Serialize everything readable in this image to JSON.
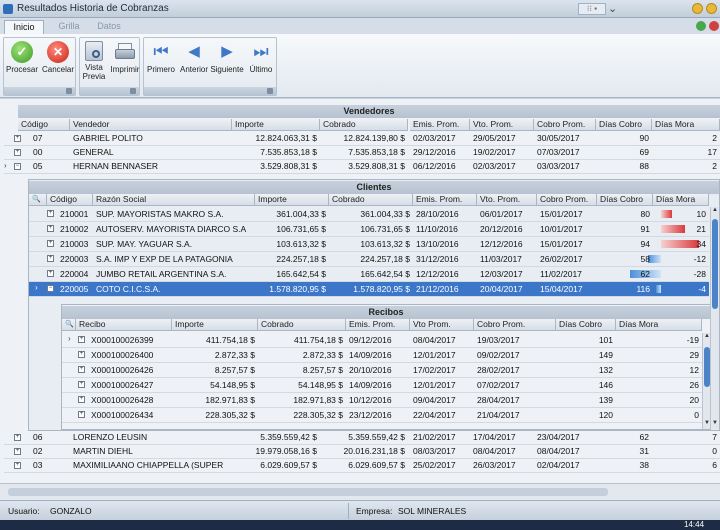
{
  "window": {
    "title": "Resultados Historia de Cobranzas"
  },
  "tabs": [
    {
      "label": "Inicio"
    },
    {
      "label": "Grilla"
    },
    {
      "label": "Datos"
    }
  ],
  "ribbon": {
    "procesar": "Procesar",
    "cancelar": "Cancelar",
    "vista_previa": "Vista Previa",
    "imprimir": "Imprimir",
    "primero": "Primero",
    "anterior": "Anterior",
    "siguiente": "Siguiente",
    "ultimo": "Último"
  },
  "vendedores": {
    "title": "Vendedores",
    "columns": [
      "Código",
      "Vendedor",
      "Importe",
      "Cobrado",
      "Emis. Prom.",
      "Vto. Prom.",
      "Cobro Prom.",
      "Días Cobro",
      "Días Mora"
    ],
    "rows": [
      {
        "codigo": "07",
        "vendedor": "GABRIEL POLITO",
        "importe": "12.824.063,31 $",
        "cobrado": "12.824.139,80 $",
        "emis": "02/03/2017",
        "vto": "29/05/2017",
        "cobro": "30/05/2017",
        "dias_cobro": "90",
        "dias_mora": "2"
      },
      {
        "codigo": "00",
        "vendedor": "GENERAL",
        "importe": "7.535.853,18 $",
        "cobrado": "7.535.853,18 $",
        "emis": "29/12/2016",
        "vto": "19/02/2017",
        "cobro": "07/03/2017",
        "dias_cobro": "69",
        "dias_mora": "17"
      },
      {
        "codigo": "05",
        "vendedor": "HERNAN BENNASER",
        "importe": "3.529.808,31 $",
        "cobrado": "3.529.808,31 $",
        "emis": "06/12/2016",
        "vto": "02/03/2017",
        "cobro": "03/03/2017",
        "dias_cobro": "88",
        "dias_mora": "2"
      }
    ],
    "rows_after": [
      {
        "codigo": "06",
        "vendedor": "LORENZO LEUSIN",
        "importe": "5.359.559,42 $",
        "cobrado": "5.359.559,42 $",
        "emis": "21/02/2017",
        "vto": "17/04/2017",
        "cobro": "23/04/2017",
        "dias_cobro": "62",
        "dias_mora": "7"
      },
      {
        "codigo": "02",
        "vendedor": "MARTIN DIEHL",
        "importe": "19.979.058,16 $",
        "cobrado": "20.016.231,18 $",
        "emis": "08/03/2017",
        "vto": "08/04/2017",
        "cobro": "08/04/2017",
        "dias_cobro": "31",
        "dias_mora": "0"
      },
      {
        "codigo": "03",
        "vendedor": "MAXIMILIAANO CHIAPPELLA (SUPER",
        "importe": "6.029.609,57 $",
        "cobrado": "6.029.609,57 $",
        "emis": "25/02/2017",
        "vto": "26/03/2017",
        "cobro": "02/04/2017",
        "dias_cobro": "38",
        "dias_mora": "6"
      }
    ]
  },
  "clientes": {
    "title": "Clientes",
    "columns": [
      "Código",
      "Razón Social",
      "Importe",
      "Cobrado",
      "Emis. Prom.",
      "Vto. Prom.",
      "Cobro Prom.",
      "Días Cobro",
      "Días Mora"
    ],
    "rows": [
      {
        "codigo": "210001",
        "razon": "SUP. MAYORISTAS MAKRO S.A.",
        "importe": "361.004,33 $",
        "cobrado": "361.004,33 $",
        "emis": "28/10/2016",
        "vto": "06/01/2017",
        "cobro": "15/01/2017",
        "dias_cobro": "80",
        "dias_mora": "10",
        "mora_frac": 0.3
      },
      {
        "codigo": "210002",
        "razon": "AUTOSERV. MAYORISTA DIARCO S.A",
        "importe": "106.731,65 $",
        "cobrado": "106.731,65 $",
        "emis": "11/10/2016",
        "vto": "20/12/2016",
        "cobro": "10/01/2017",
        "dias_cobro": "91",
        "dias_mora": "21",
        "mora_frac": 0.62
      },
      {
        "codigo": "210003",
        "razon": "SUP. MAY. YAGUAR S.A.",
        "importe": "103.613,32 $",
        "cobrado": "103.613,32 $",
        "emis": "13/10/2016",
        "vto": "12/12/2016",
        "cobro": "15/01/2017",
        "dias_cobro": "94",
        "dias_mora": "34",
        "mora_frac": 1.0
      },
      {
        "codigo": "220003",
        "razon": "S.A. IMP Y EXP DE LA PATAGONIA",
        "importe": "224.257,18 $",
        "cobrado": "224.257,18 $",
        "emis": "31/12/2016",
        "vto": "11/03/2017",
        "cobro": "26/02/2017",
        "dias_cobro": "58",
        "dias_mora": "-12",
        "mora_frac": -0.35
      },
      {
        "codigo": "220004",
        "razon": "JUMBO RETAIL ARGENTINA S.A.",
        "importe": "165.642,54 $",
        "cobrado": "165.642,54 $",
        "emis": "12/12/2016",
        "vto": "12/03/2017",
        "cobro": "11/02/2017",
        "dias_cobro": "62",
        "dias_mora": "-28",
        "mora_frac": -0.82
      },
      {
        "codigo": "220005",
        "razon": "COTO C.I.C.S.A.",
        "importe": "1.578.820,95 $",
        "cobrado": "1.578.820,95 $",
        "emis": "21/12/2016",
        "vto": "20/04/2017",
        "cobro": "15/04/2017",
        "dias_cobro": "116",
        "dias_mora": "-4",
        "mora_frac": -0.12
      }
    ]
  },
  "recibos": {
    "title": "Recibos",
    "columns": [
      "Recibo",
      "Importe",
      "Cobrado",
      "Emis. Prom.",
      "Vto Prom.",
      "Cobro Prom.",
      "Días Cobro",
      "Días Mora"
    ],
    "rows": [
      {
        "recibo": "X000100026399",
        "importe": "411.754,18 $",
        "cobrado": "411.754,18 $",
        "emis": "09/12/2016",
        "vto": "08/04/2017",
        "cobro": "19/03/2017",
        "dias_cobro": "101",
        "dias_mora": "-19"
      },
      {
        "recibo": "X000100026400",
        "importe": "2.872,33 $",
        "cobrado": "2.872,33 $",
        "emis": "14/09/2016",
        "vto": "12/01/2017",
        "cobro": "09/02/2017",
        "dias_cobro": "149",
        "dias_mora": "29"
      },
      {
        "recibo": "X000100026426",
        "importe": "8.257,57 $",
        "cobrado": "8.257,57 $",
        "emis": "20/10/2016",
        "vto": "17/02/2017",
        "cobro": "28/02/2017",
        "dias_cobro": "132",
        "dias_mora": "12"
      },
      {
        "recibo": "X000100026427",
        "importe": "54.148,95 $",
        "cobrado": "54.148,95 $",
        "emis": "14/09/2016",
        "vto": "12/01/2017",
        "cobro": "07/02/2017",
        "dias_cobro": "146",
        "dias_mora": "26"
      },
      {
        "recibo": "X000100026428",
        "importe": "182.971,83 $",
        "cobrado": "182.971,83 $",
        "emis": "10/12/2016",
        "vto": "09/04/2017",
        "cobro": "28/04/2017",
        "dias_cobro": "139",
        "dias_mora": "20"
      },
      {
        "recibo": "X000100026434",
        "importe": "228.305,32 $",
        "cobrado": "228.305,32 $",
        "emis": "23/12/2016",
        "vto": "22/04/2017",
        "cobro": "21/04/2017",
        "dias_cobro": "120",
        "dias_mora": "0"
      }
    ]
  },
  "status": {
    "usuario_label": "Usuario:",
    "usuario": "GONZALO",
    "empresa_label": "Empresa:",
    "empresa": "SOL MINERALES"
  },
  "taskbar": {
    "time": "14:44"
  },
  "colors": {
    "selected": "#3b76c9",
    "mora_positive": "#d9393a",
    "mora_negative": "#4a90d9"
  }
}
